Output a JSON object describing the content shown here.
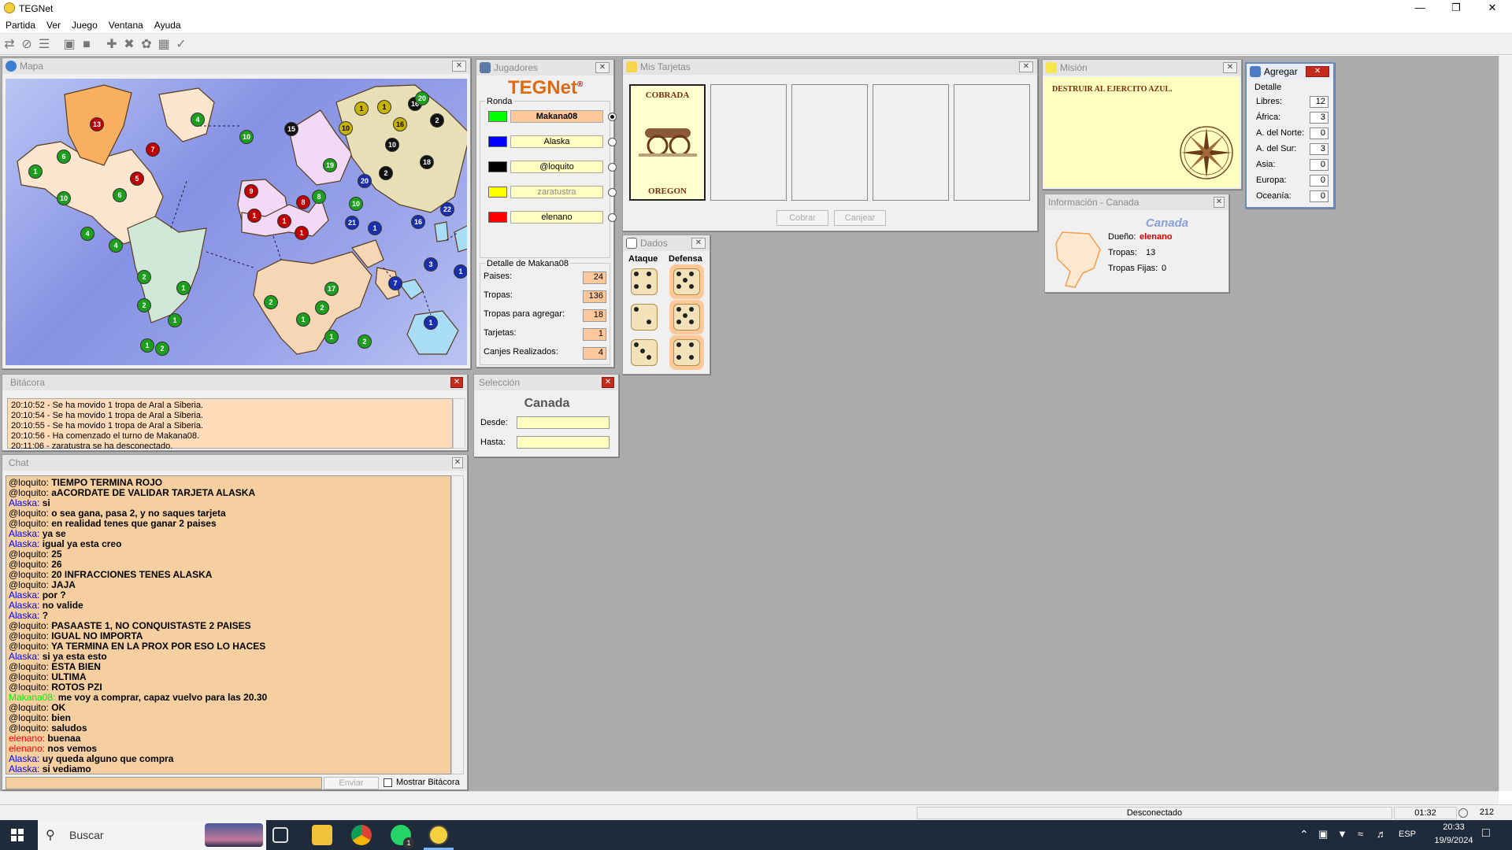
{
  "window": {
    "title": "TEGNet"
  },
  "menu": [
    "Partida",
    "Ver",
    "Juego",
    "Ventana",
    "Ayuda"
  ],
  "map_window": {
    "title": "Mapa",
    "armies": [
      {
        "n": "13",
        "c": "#c00000"
      },
      {
        "n": "7",
        "c": "#c00000"
      },
      {
        "n": "5",
        "c": "#c00000"
      },
      {
        "n": "6",
        "c": "#1e9e1e"
      },
      {
        "n": "1",
        "c": "#1e9e1e"
      },
      {
        "n": "4",
        "c": "#1e9e1e"
      },
      {
        "n": "10",
        "c": "#1e9e1e"
      },
      {
        "n": "6",
        "c": "#1e9e1e"
      },
      {
        "n": "4",
        "c": "#1e9e1e"
      },
      {
        "n": "4",
        "c": "#1e9e1e"
      },
      {
        "n": "2",
        "c": "#1e9e1e"
      },
      {
        "n": "2",
        "c": "#1e9e1e"
      },
      {
        "n": "1",
        "c": "#1e9e1e"
      },
      {
        "n": "1",
        "c": "#1e9e1e"
      },
      {
        "n": "1",
        "c": "#1e9e1e"
      },
      {
        "n": "2",
        "c": "#1e9e1e"
      },
      {
        "n": "10",
        "c": "#1e9e1e"
      },
      {
        "n": "15",
        "c": "#111111"
      },
      {
        "n": "9",
        "c": "#c00000"
      },
      {
        "n": "19",
        "c": "#1e9e1e"
      },
      {
        "n": "8",
        "c": "#c00000"
      },
      {
        "n": "8",
        "c": "#1e9e1e"
      },
      {
        "n": "1",
        "c": "#c00000"
      },
      {
        "n": "1",
        "c": "#c00000"
      },
      {
        "n": "1",
        "c": "#c00000"
      },
      {
        "n": "1",
        "c": "#c8b400"
      },
      {
        "n": "1",
        "c": "#c8b400"
      },
      {
        "n": "10",
        "c": "#c8b400"
      },
      {
        "n": "16",
        "c": "#c8b400"
      },
      {
        "n": "16",
        "c": "#111111"
      },
      {
        "n": "10",
        "c": "#111111"
      },
      {
        "n": "20",
        "c": "#1e9e1e"
      },
      {
        "n": "2",
        "c": "#111111"
      },
      {
        "n": "18",
        "c": "#111111"
      },
      {
        "n": "2",
        "c": "#111111"
      },
      {
        "n": "20",
        "c": "#1a2fb0"
      },
      {
        "n": "10",
        "c": "#1e9e1e"
      },
      {
        "n": "21",
        "c": "#1a2fb0"
      },
      {
        "n": "1",
        "c": "#1a2fb0"
      },
      {
        "n": "16",
        "c": "#1a2fb0"
      },
      {
        "n": "22",
        "c": "#1a2fb0"
      },
      {
        "n": "2",
        "c": "#1e9e1e"
      },
      {
        "n": "17",
        "c": "#1e9e1e"
      },
      {
        "n": "2",
        "c": "#1e9e1e"
      },
      {
        "n": "1",
        "c": "#1e9e1e"
      },
      {
        "n": "1",
        "c": "#1e9e1e"
      },
      {
        "n": "2",
        "c": "#1e9e1e"
      },
      {
        "n": "3",
        "c": "#1a2fb0"
      },
      {
        "n": "7",
        "c": "#1a2fb0"
      },
      {
        "n": "1",
        "c": "#1a2fb0"
      },
      {
        "n": "1",
        "c": "#1a2fb0"
      }
    ]
  },
  "players_window": {
    "title": "Jugadores",
    "logo": "TEGNet",
    "logo_reg": "®",
    "round_label": "Ronda",
    "players": [
      {
        "name": "Makana08",
        "color": "#00ff00",
        "selected": true
      },
      {
        "name": "Alaska",
        "color": "#0000ff",
        "selected": false
      },
      {
        "name": "@loquito",
        "color": "#000000",
        "selected": false
      },
      {
        "name": "zaratustra",
        "color": "#ffff00",
        "selected": false
      },
      {
        "name": "elenano",
        "color": "#ff0000",
        "selected": false
      }
    ],
    "detail_label": "Detalle de Makana08",
    "stats": [
      {
        "label": "Paises:",
        "value": "24"
      },
      {
        "label": "Tropas:",
        "value": "136"
      },
      {
        "label": "Tropas para agregar:",
        "value": "18"
      },
      {
        "label": "Tarjetas:",
        "value": "1"
      },
      {
        "label": "Canjes Realizados:",
        "value": "4"
      }
    ]
  },
  "cards_window": {
    "title": "Mis Tarjetas",
    "card_status": "COBRADA",
    "card_country": "OREGON",
    "cobrar": "Cobrar",
    "canjear": "Canjear"
  },
  "mission_window": {
    "title": "Misión",
    "text": "DESTRUIR AL EJERCITO AZUL."
  },
  "add_window": {
    "title": "Agregar",
    "group": "Detalle",
    "rows": [
      {
        "label": "Libres:",
        "value": "12"
      },
      {
        "label": "África:",
        "value": "3"
      },
      {
        "label": "A. del Norte:",
        "value": "0"
      },
      {
        "label": "A. del Sur:",
        "value": "3"
      },
      {
        "label": "Asia:",
        "value": "0"
      },
      {
        "label": "Europa:",
        "value": "0"
      },
      {
        "label": "Oceanía:",
        "value": "0"
      }
    ]
  },
  "info_window": {
    "title": "Información - Canada",
    "country": "Canada",
    "owner_label": "Dueño:",
    "owner": "elenano",
    "troops_label": "Tropas:",
    "troops": "13",
    "fixed_label": "Tropas Fijas:",
    "fixed": "0"
  },
  "dice_window": {
    "title": "Dados",
    "attack": "Ataque",
    "defense": "Defensa",
    "attack_values": [
      4,
      2,
      3
    ],
    "defense_values": [
      5,
      5,
      4
    ]
  },
  "log_window": {
    "title": "Bitácora",
    "lines": [
      "20:10:52 - Se ha movido 1 tropa de Aral a Siberia.",
      "20:10:54 - Se ha movido 1 tropa de Aral a Siberia.",
      "20:10:55 - Se ha movido 1 tropa de Aral a Siberia.",
      "20:10:56 - Ha comenzado el turno de Makana08.",
      "20:11:06 - zaratustra se ha desconectado."
    ]
  },
  "selection_window": {
    "title": "Selección",
    "country": "Canada",
    "from_label": "Desde:",
    "to_label": "Hasta:",
    "from_value": "",
    "to_value": ""
  },
  "chat_window": {
    "title": "Chat",
    "send": "Enviar",
    "show_log": "Mostrar Bitácora",
    "input_value": "",
    "messages": [
      {
        "who": "@loquito",
        "color": "#000000",
        "text": "TIEMPO TERMINA ROJO"
      },
      {
        "who": "@loquito",
        "color": "#000000",
        "text": "aACORDATE DE VALIDAR TARJETA ALASKA"
      },
      {
        "who": "Alaska",
        "color": "#0000ff",
        "text": "si"
      },
      {
        "who": "@loquito",
        "color": "#000000",
        "text": "o sea gana, pasa 2, y no saques tarjeta"
      },
      {
        "who": "@loquito",
        "color": "#000000",
        "text": "en realidad tenes que ganar 2 paises"
      },
      {
        "who": "Alaska",
        "color": "#0000ff",
        "text": "ya se"
      },
      {
        "who": "Alaska",
        "color": "#0000ff",
        "text": "igual ya esta creo"
      },
      {
        "who": "@loquito",
        "color": "#000000",
        "text": "25"
      },
      {
        "who": "@loquito",
        "color": "#000000",
        "text": "26"
      },
      {
        "who": "@loquito",
        "color": "#000000",
        "text": "20 INFRACCIONES TENES ALASKA"
      },
      {
        "who": "@loquito",
        "color": "#000000",
        "text": "JAJA"
      },
      {
        "who": "Alaska",
        "color": "#0000ff",
        "text": "por ?"
      },
      {
        "who": "Alaska",
        "color": "#0000ff",
        "text": "no valide"
      },
      {
        "who": "Alaska",
        "color": "#0000ff",
        "text": "?"
      },
      {
        "who": "@loquito",
        "color": "#000000",
        "text": "PASAASTE 1, NO CONQUISTASTE 2 PAISES"
      },
      {
        "who": "@loquito",
        "color": "#000000",
        "text": "IGUAL NO IMPORTA"
      },
      {
        "who": "@loquito",
        "color": "#000000",
        "text": "YA TERMINA EN LA PROX POR ESO LO HACES"
      },
      {
        "who": "Alaska",
        "color": "#0000ff",
        "text": "si ya esta esto"
      },
      {
        "who": "@loquito",
        "color": "#000000",
        "text": "ESTA BIEN"
      },
      {
        "who": "@loquito",
        "color": "#000000",
        "text": "ULTIMA"
      },
      {
        "who": "@loquito",
        "color": "#000000",
        "text": "ROTOS PZI"
      },
      {
        "who": "Makana08",
        "color": "#00ee00",
        "text": "me voy a comprar, capaz vuelvo para las 20.30"
      },
      {
        "who": "@loquito",
        "color": "#000000",
        "text": "OK"
      },
      {
        "who": "@loquito",
        "color": "#000000",
        "text": "bien"
      },
      {
        "who": "@loquito",
        "color": "#000000",
        "text": "saludos"
      },
      {
        "who": "elenano",
        "color": "#ff0000",
        "text": "buenaa"
      },
      {
        "who": "elenano",
        "color": "#ff0000",
        "text": "nos vemos"
      },
      {
        "who": "Alaska",
        "color": "#0000ff",
        "text": "uy queda alguno que compra"
      },
      {
        "who": "Alaska",
        "color": "#0000ff",
        "text": "si vediamo"
      }
    ]
  },
  "status": {
    "connection": "Desconectado",
    "time": "01:32",
    "count": "212"
  },
  "taskbar": {
    "search": "Buscar",
    "lang": "ESP",
    "clock": "20:33",
    "date": "19/9/2024",
    "badge": "1"
  }
}
